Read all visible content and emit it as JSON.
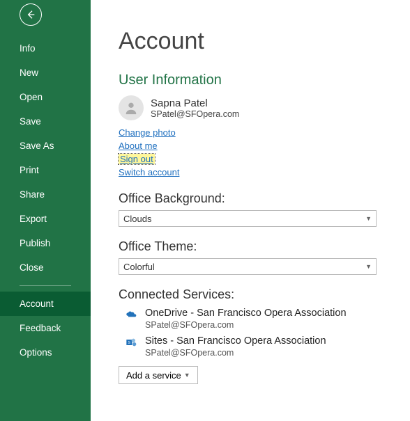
{
  "sidebar": {
    "items": [
      {
        "label": "Info"
      },
      {
        "label": "New"
      },
      {
        "label": "Open"
      },
      {
        "label": "Save"
      },
      {
        "label": "Save As"
      },
      {
        "label": "Print"
      },
      {
        "label": "Share"
      },
      {
        "label": "Export"
      },
      {
        "label": "Publish"
      },
      {
        "label": "Close"
      }
    ],
    "meta": [
      {
        "label": "Account",
        "active": true
      },
      {
        "label": "Feedback"
      },
      {
        "label": "Options"
      }
    ]
  },
  "page": {
    "title": "Account",
    "user_info_heading": "User Information",
    "user": {
      "name": "Sapna Patel",
      "email": "SPatel@SFOpera.com"
    },
    "links": {
      "change_photo": "Change photo",
      "about_me": "About me",
      "sign_out": "Sign out",
      "switch_account": "Switch account"
    },
    "background": {
      "heading": "Office Background:",
      "value": "Clouds"
    },
    "theme": {
      "heading": "Office Theme:",
      "value": "Colorful"
    },
    "connected": {
      "heading": "Connected Services:",
      "services": [
        {
          "title": "OneDrive - San Francisco Opera Association",
          "email": "SPatel@SFOpera.com"
        },
        {
          "title": "Sites - San Francisco Opera Association",
          "email": "SPatel@SFOpera.com"
        }
      ],
      "add_label": "Add a service"
    }
  }
}
